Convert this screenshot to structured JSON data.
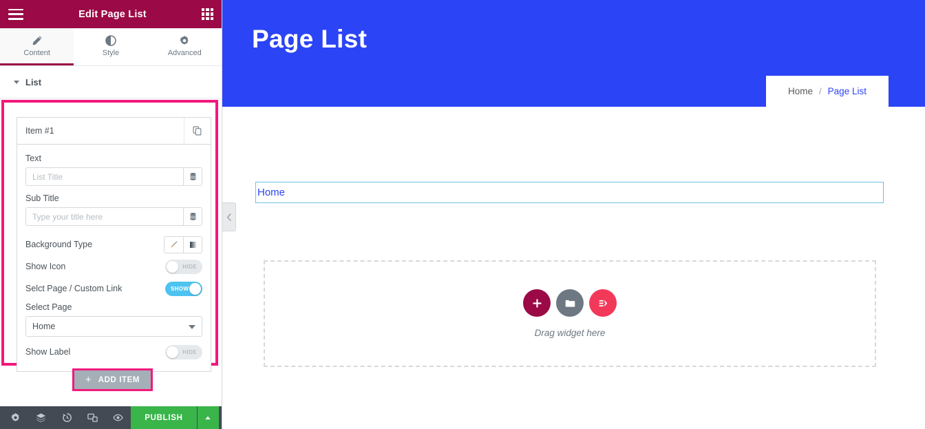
{
  "panel": {
    "header": {
      "menu_icon": "hamburger-icon",
      "title": "Edit Page List",
      "widgets_icon": "grid-icon"
    },
    "tabs": [
      {
        "label": "Content",
        "icon": "pencil-icon",
        "active": true
      },
      {
        "label": "Style",
        "icon": "contrast-icon",
        "active": false
      },
      {
        "label": "Advanced",
        "icon": "gear-icon",
        "active": false
      }
    ],
    "section": {
      "title": "List",
      "caret": "caret-down-icon"
    },
    "repeater": {
      "item_label": "Item #1",
      "duplicate_icon": "copy-icon",
      "fields": [
        {
          "label": "Text",
          "value": "",
          "placeholder": "List Title",
          "dynamic_icon": "database-icon"
        },
        {
          "label": "Sub Title",
          "value": "",
          "placeholder": "Type your title here",
          "dynamic_icon": "database-icon"
        }
      ],
      "background_type": {
        "label": "Background Type",
        "options": [
          {
            "name": "classic",
            "icon": "paint-brush-icon"
          },
          {
            "name": "gradient",
            "icon": "gradient-bar-icon"
          }
        ]
      },
      "show_icon": {
        "label": "Show Icon",
        "state": "HIDE",
        "on": false
      },
      "select_link": {
        "label": "Selct Page / Custom Link",
        "state": "SHOW",
        "on": true
      },
      "select_page": {
        "label": "Select Page",
        "value": "Home",
        "options": [
          "Home"
        ]
      },
      "show_label": {
        "label": "Show Label",
        "state": "HIDE",
        "on": false
      }
    },
    "add_item": {
      "label": "ADD ITEM",
      "plus_icon": "plus-icon"
    },
    "footer": {
      "icons": [
        "settings-gear-icon",
        "navigator-layers-icon",
        "history-clock-icon",
        "responsive-mode-icon",
        "preview-eye-icon"
      ],
      "publish_label": "PUBLISH",
      "publish_arrow_icon": "caret-up-icon"
    }
  },
  "preview": {
    "collapse_handle_icon": "chevron-left-icon",
    "hero_title": "Page List",
    "breadcrumb": {
      "home": "Home",
      "separator": "/",
      "current": "Page List"
    },
    "home_widget_link": "Home",
    "dropzone": {
      "text": "Drag widget here",
      "buttons": [
        {
          "name": "add-section-button",
          "icon": "plus-icon"
        },
        {
          "name": "add-template-button",
          "icon": "folder-icon"
        },
        {
          "name": "elementor-logo-button",
          "icon": "elementor-logo-icon"
        }
      ]
    }
  },
  "colors": {
    "panel_header": "#9b0a46",
    "accent_pink": "#f2197d",
    "switch_on": "#4fc3f0",
    "publish_green": "#39b54a",
    "hero_blue": "#2b44f5",
    "footer_dark": "#434a54",
    "widget_outline": "#6ec1e4"
  }
}
